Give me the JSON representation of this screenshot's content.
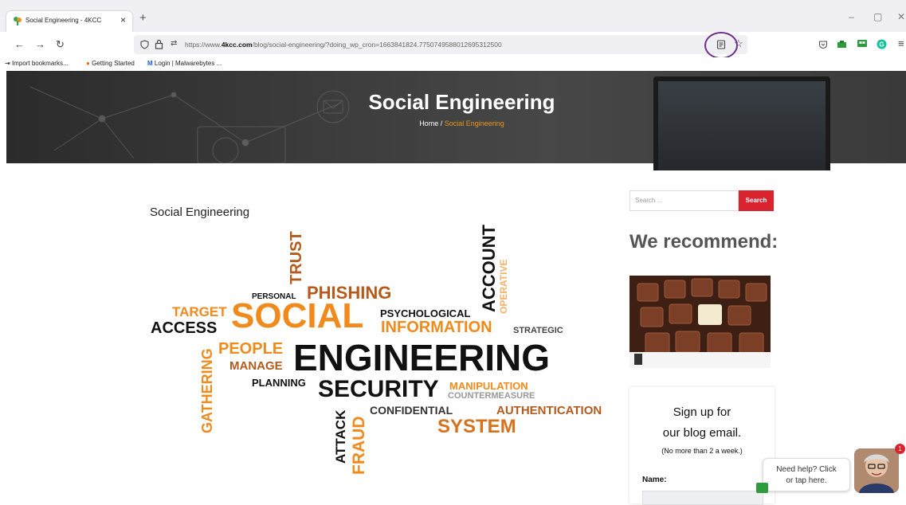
{
  "browser": {
    "tab_title": "Social Engineering - 4KCC",
    "tab_close": "×",
    "new_tab": "+",
    "url_prefix": "https://www.",
    "url_domain": "4kcc.com",
    "url_rest": "/blog/social-engineering/?doing_wp_cron=1663841824.7750749588012695312500",
    "window_controls": [
      "–",
      "▢",
      "✕"
    ],
    "bookmarks": [
      {
        "label": "Import bookmarks...",
        "icon": "import-icon"
      },
      {
        "label": "Getting Started",
        "icon": "firefox-icon"
      },
      {
        "label": "Login | Malwarebytes ...",
        "icon": "malwarebytes-icon"
      }
    ]
  },
  "hero": {
    "title": "Social Engineering",
    "breadcrumb_home": "Home",
    "breadcrumb_sep": "/",
    "breadcrumb_current": "Social Engineering"
  },
  "post": {
    "title": "Social Engineering"
  },
  "word_cloud": {
    "words": [
      "TRUST",
      "PERSONAL",
      "PHISHING",
      "ACCOUNT",
      "OPERATIVE",
      "TARGET",
      "SOCIAL",
      "PSYCHOLOGICAL",
      "INFORMATION",
      "STRATEGIC",
      "ACCESS",
      "GATHERING",
      "PEOPLE",
      "MANAGE",
      "ENGINEERING",
      "PLANNING",
      "SECURITY",
      "MANIPULATION",
      "COUNTERMEASURE",
      "ATTACK",
      "FRAUD",
      "CONFIDENTIAL",
      "AUTHENTICATION",
      "SYSTEM"
    ]
  },
  "sidebar": {
    "search_placeholder": "Search ...",
    "search_button": "Search",
    "recommend_title": "We recommend:",
    "signup_title_1": "Sign up for",
    "signup_title_2": "our blog email.",
    "signup_note": "(No more than 2 a week.)",
    "name_label": "Name:"
  },
  "chat": {
    "line1": "Need help? Click",
    "line2": "or tap here.",
    "badge_count": "1"
  },
  "colors": {
    "accent_orange": "#f08a1c",
    "search_red": "#d9232e",
    "highlight_circle": "#6b2d8a"
  }
}
